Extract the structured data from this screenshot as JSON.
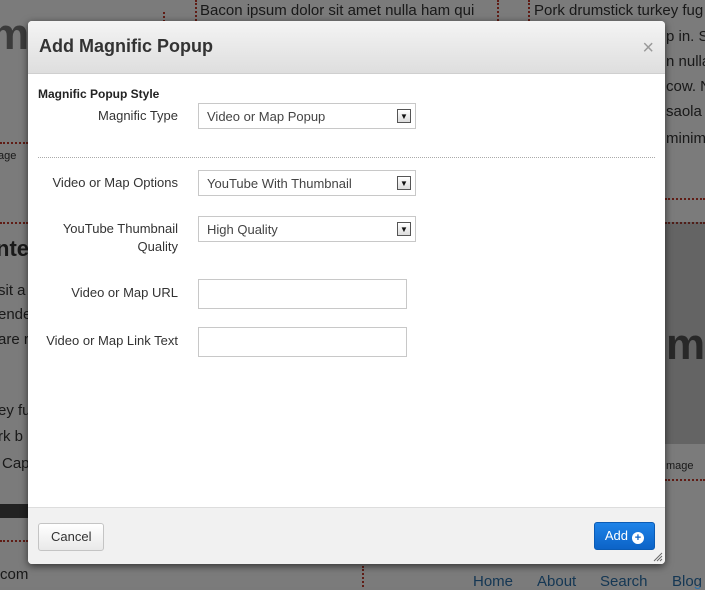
{
  "background": {
    "snippets": [
      "Bacon ipsum dolor sit amet nulla ham qui",
      "Pork drumstick turkey fug",
      "p in. S",
      "n nulla",
      "cow. N",
      "saola",
      "minim",
      "nte",
      "sit a",
      "ende",
      "are ri",
      "ey fu",
      "rk b",
      "Cap",
      "age",
      "mage",
      "com"
    ],
    "nav": [
      "Home",
      "About",
      "Search",
      "Blog"
    ]
  },
  "modal": {
    "title": "Add Magnific Popup",
    "close_glyph": "×",
    "section_title": "Magnific Popup Style",
    "fields": {
      "magnific_type_label": "Magnific Type",
      "magnific_type_value": "Video or Map Popup",
      "options_label": "Video or Map Options",
      "options_value": "YouTube With Thumbnail",
      "thumb_quality_label_line1": "YouTube Thumbnail",
      "thumb_quality_label_line2": "Quality",
      "thumb_quality_value": "High Quality",
      "url_label": "Video or Map URL",
      "url_value": "",
      "link_text_label": "Video or Map Link Text",
      "link_text_value": ""
    },
    "footer": {
      "cancel_label": "Cancel",
      "add_label": "Add"
    },
    "icons": {
      "close": "close-icon",
      "dropdown": "chevron-down-icon",
      "add": "plus-circle-icon",
      "resize": "resize-grip-icon"
    },
    "colors": {
      "primary": "#0c63c7",
      "header_bg": "#e6e6e6"
    }
  }
}
